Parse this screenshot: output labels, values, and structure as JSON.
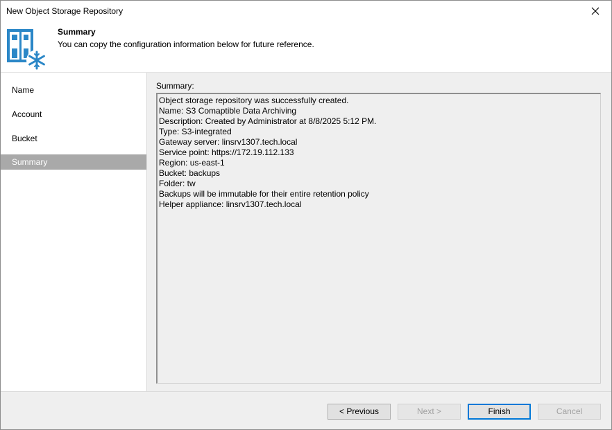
{
  "window": {
    "title": "New Object Storage Repository"
  },
  "header": {
    "title": "Summary",
    "subtitle": "You can copy the configuration information below for future reference."
  },
  "sidebar": {
    "items": [
      {
        "label": "Name",
        "active": false
      },
      {
        "label": "Account",
        "active": false
      },
      {
        "label": "Bucket",
        "active": false
      },
      {
        "label": "Summary",
        "active": true
      }
    ]
  },
  "content": {
    "summary_label": "Summary:",
    "summary_lines": [
      "Object storage repository was successfully created.",
      "Name: S3 Comaptible Data Archiving",
      "Description: Created by Administrator at 8/8/2025 5:12 PM.",
      "Type: S3-integrated",
      "Gateway server: linsrv1307.tech.local",
      "Service point: https://172.19.112.133",
      "Region: us-east-1",
      "Bucket: backups",
      "Folder: tw",
      "Backups will be immutable for their entire retention policy",
      "Helper appliance: linsrv1307.tech.local"
    ]
  },
  "footer": {
    "previous_label": "< Previous",
    "next_label": "Next >",
    "finish_label": "Finish",
    "cancel_label": "Cancel"
  },
  "icons": {
    "close": "close-icon",
    "wizard": "object-storage-immutable-icon"
  },
  "colors": {
    "accent": "#0078d7",
    "active_nav": "#a9a9a9",
    "icon_blue": "#2b87c7"
  }
}
